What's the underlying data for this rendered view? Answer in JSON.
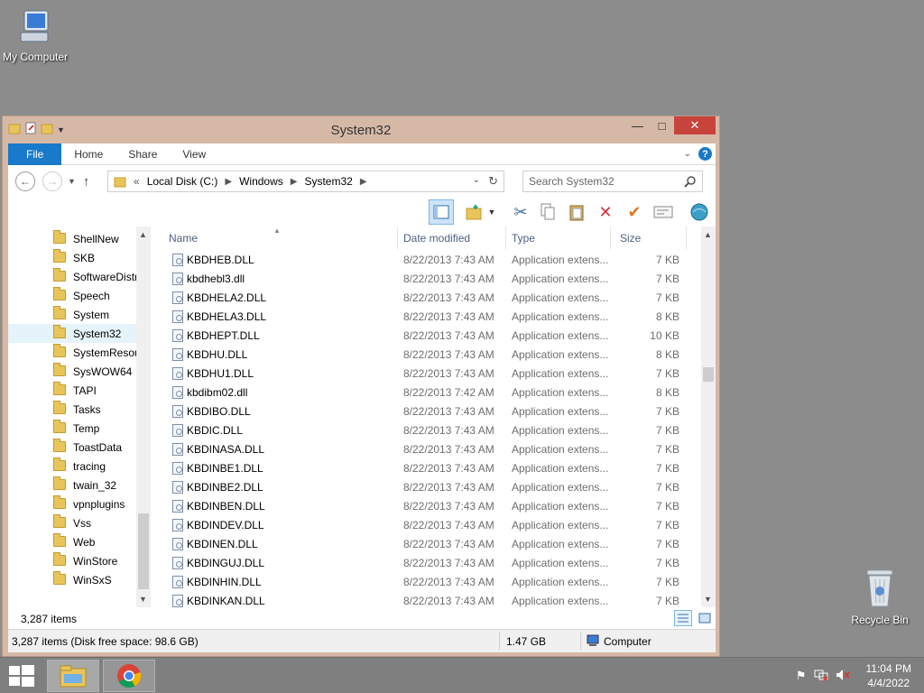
{
  "desktop": {
    "icons": [
      {
        "label": "My Computer"
      },
      {
        "label": "Recycle Bin"
      }
    ]
  },
  "window": {
    "title": "System32",
    "controls": {
      "minimize": "—",
      "maximize": "□",
      "close": "✕"
    }
  },
  "ribbon": {
    "tabs": [
      "File",
      "Home",
      "Share",
      "View"
    ]
  },
  "address": {
    "prefix": "«",
    "crumbs": [
      "Local Disk (C:)",
      "Windows",
      "System32"
    ]
  },
  "search": {
    "placeholder": "Search System32"
  },
  "nav_pane": {
    "items": [
      "ShellNew",
      "SKB",
      "SoftwareDistr",
      "Speech",
      "System",
      "System32",
      "SystemResou",
      "SysWOW64",
      "TAPI",
      "Tasks",
      "Temp",
      "ToastData",
      "tracing",
      "twain_32",
      "vpnplugins",
      "Vss",
      "Web",
      "WinStore",
      "WinSxS"
    ],
    "selected": "System32"
  },
  "columns": {
    "name": "Name",
    "date": "Date modified",
    "type": "Type",
    "size": "Size"
  },
  "files": [
    {
      "name": "KBDHEB.DLL",
      "date": "8/22/2013 7:43 AM",
      "type": "Application extens...",
      "size": "7 KB"
    },
    {
      "name": "kbdhebl3.dll",
      "date": "8/22/2013 7:43 AM",
      "type": "Application extens...",
      "size": "7 KB"
    },
    {
      "name": "KBDHELA2.DLL",
      "date": "8/22/2013 7:43 AM",
      "type": "Application extens...",
      "size": "7 KB"
    },
    {
      "name": "KBDHELA3.DLL",
      "date": "8/22/2013 7:43 AM",
      "type": "Application extens...",
      "size": "8 KB"
    },
    {
      "name": "KBDHEPT.DLL",
      "date": "8/22/2013 7:43 AM",
      "type": "Application extens...",
      "size": "10 KB"
    },
    {
      "name": "KBDHU.DLL",
      "date": "8/22/2013 7:43 AM",
      "type": "Application extens...",
      "size": "8 KB"
    },
    {
      "name": "KBDHU1.DLL",
      "date": "8/22/2013 7:43 AM",
      "type": "Application extens...",
      "size": "7 KB"
    },
    {
      "name": "kbdibm02.dll",
      "date": "8/22/2013 7:42 AM",
      "type": "Application extens...",
      "size": "8 KB"
    },
    {
      "name": "KBDIBO.DLL",
      "date": "8/22/2013 7:43 AM",
      "type": "Application extens...",
      "size": "7 KB"
    },
    {
      "name": "KBDIC.DLL",
      "date": "8/22/2013 7:43 AM",
      "type": "Application extens...",
      "size": "7 KB"
    },
    {
      "name": "KBDINASA.DLL",
      "date": "8/22/2013 7:43 AM",
      "type": "Application extens...",
      "size": "7 KB"
    },
    {
      "name": "KBDINBE1.DLL",
      "date": "8/22/2013 7:43 AM",
      "type": "Application extens...",
      "size": "7 KB"
    },
    {
      "name": "KBDINBE2.DLL",
      "date": "8/22/2013 7:43 AM",
      "type": "Application extens...",
      "size": "7 KB"
    },
    {
      "name": "KBDINBEN.DLL",
      "date": "8/22/2013 7:43 AM",
      "type": "Application extens...",
      "size": "7 KB"
    },
    {
      "name": "KBDINDEV.DLL",
      "date": "8/22/2013 7:43 AM",
      "type": "Application extens...",
      "size": "7 KB"
    },
    {
      "name": "KBDINEN.DLL",
      "date": "8/22/2013 7:43 AM",
      "type": "Application extens...",
      "size": "7 KB"
    },
    {
      "name": "KBDINGUJ.DLL",
      "date": "8/22/2013 7:43 AM",
      "type": "Application extens...",
      "size": "7 KB"
    },
    {
      "name": "KBDINHIN.DLL",
      "date": "8/22/2013 7:43 AM",
      "type": "Application extens...",
      "size": "7 KB"
    },
    {
      "name": "KBDINKAN.DLL",
      "date": "8/22/2013 7:43 AM",
      "type": "Application extens...",
      "size": "7 KB"
    }
  ],
  "item_count": "3,287 items",
  "status": {
    "left": "3,287 items (Disk free space: 98.6 GB)",
    "middle": "1.47 GB",
    "right": "Computer"
  },
  "taskbar": {
    "apps": [
      "file-explorer-icon",
      "chrome-icon"
    ],
    "clock_time": "11:04 PM",
    "clock_date": "4/4/2022"
  },
  "colors": {
    "accent": "#1979ca",
    "window_frame": "#d6b8a6",
    "close_button": "#c7443d",
    "desktop": "#8c8c8c"
  }
}
